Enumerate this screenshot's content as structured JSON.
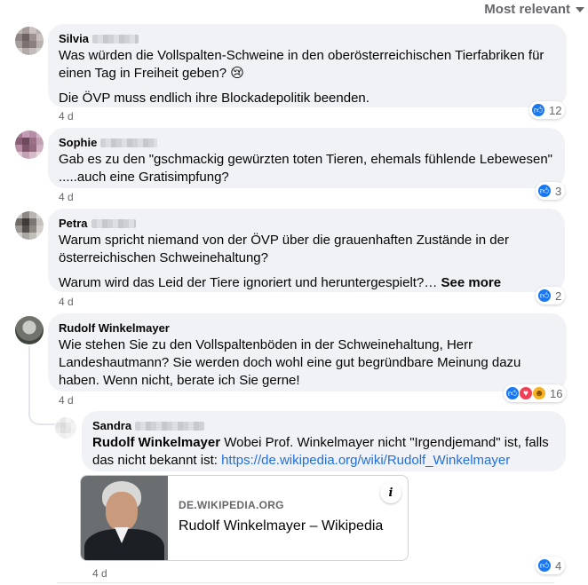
{
  "sort": {
    "label": "Most relevant",
    "icon": "caret-down-icon"
  },
  "comments": [
    {
      "author": "Silvia",
      "paragraphs": [
        "Was würden die Vollspalten-Schweine in den oberösterreichischen Tierfabriken für einen Tag in Freiheit geben? 😢",
        "Die ÖVP muss endlich ihre Blockadepolitik beenden."
      ],
      "timestamp": "4 d",
      "reactions": {
        "count": "12",
        "types": [
          "like"
        ]
      }
    },
    {
      "author": "Sophie",
      "paragraphs": [
        "Gab es zu den \"gschmackig gewürzten toten Tieren, ehemals fühlende Lebewesen\" .....auch eine Gratisimpfung?"
      ],
      "timestamp": "4 d",
      "reactions": {
        "count": "3",
        "types": [
          "like"
        ]
      }
    },
    {
      "author": "Petra",
      "paragraphs": [
        "Warum spricht niemand von der ÖVP über die grauenhaften Zustände in der österreichischen Schweinehaltung?",
        "Warum wird das Leid der Tiere ignoriert und heruntergespielt?…"
      ],
      "see_more": "See more",
      "timestamp": "4 d",
      "reactions": {
        "count": "2",
        "types": [
          "like"
        ]
      }
    },
    {
      "author": "Rudolf Winkelmayer",
      "paragraphs": [
        "Wie stehen Sie zu den Vollspaltenböden in der Schweinehaltung, Herr Landeshautmann? Sie werden doch wohl eine gut begründbare Meinung dazu haben. Wenn nicht, berate ich Sie gerne!"
      ],
      "timestamp": "4 d",
      "reactions": {
        "count": "16",
        "types": [
          "like",
          "love",
          "care"
        ]
      }
    }
  ],
  "reply": {
    "author": "Sandra",
    "mention": "Rudolf Winkelmayer",
    "text": " Wobei Prof. Winkelmayer nicht \"Irgendjemand\" ist, falls das nicht bekannt ist: ",
    "link": "https://de.wikipedia.org/wiki/Rudolf_Winkelmayer",
    "card": {
      "domain": "DE.WIKIPEDIA.ORG",
      "title": "Rudolf Winkelmayer – Wikipedia",
      "info_icon": "info-icon"
    },
    "timestamp": "4 d",
    "reactions": {
      "count": "4",
      "types": [
        "like"
      ]
    }
  },
  "colors": {
    "bubble": "#f0f2f5",
    "secondary_text": "#65676b",
    "link": "#216fdb",
    "like": "#1877f2",
    "love": "#f33e58",
    "care": "#f7b125"
  }
}
